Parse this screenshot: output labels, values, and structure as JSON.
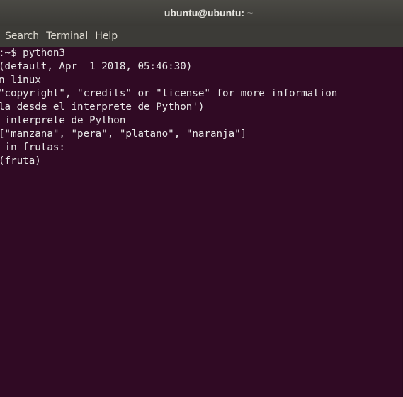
{
  "window": {
    "title": "ubuntu@ubuntu: ~"
  },
  "menu": {
    "items": [
      "Search",
      "Terminal",
      "Help"
    ]
  },
  "terminal": {
    "lines": [
      ":~$ python3",
      "(default, Apr  1 2018, 05:46:30)",
      "n linux",
      "\"copyright\", \"credits\" or \"license\" for more information",
      "la desde el interprete de Python')",
      " interprete de Python",
      "[\"manzana\", \"pera\", \"platano\", \"naranja\"]",
      " in frutas:",
      "(fruta)"
    ]
  },
  "colors": {
    "terminal_bg": "#300a24",
    "titlebar_bg": "#3f3e3a",
    "menubar_bg": "#3c3b37",
    "text": "#e8e8e8"
  }
}
